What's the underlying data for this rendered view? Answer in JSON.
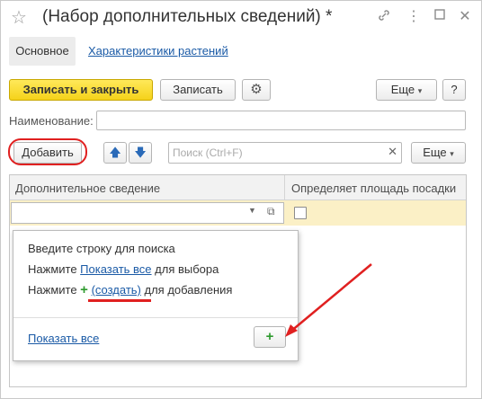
{
  "window": {
    "title": "(Набор дополнительных сведений) *",
    "link_icon": "link-icon",
    "menu_icon": "menu-icon",
    "maximize_icon": "maximize-icon",
    "close_icon": "close-icon"
  },
  "tabs": {
    "main": "Основное",
    "link": "Характеристики растений"
  },
  "toolbar": {
    "save_close": "Записать и закрыть",
    "save": "Записать",
    "more": "Еще",
    "help": "?"
  },
  "form": {
    "name_label": "Наименование:",
    "name_value": ""
  },
  "list_toolbar": {
    "add": "Добавить",
    "search_placeholder": "Поиск (Ctrl+F)",
    "more": "Еще"
  },
  "table": {
    "columns": [
      "Дополнительное сведение",
      "Определяет площадь посадки"
    ],
    "edit_value": ""
  },
  "popup": {
    "line1": "Введите строку для поиска",
    "line2_prefix": "Нажмите ",
    "line2_link": "Показать все",
    "line2_suffix": " для выбора",
    "line3_prefix": "Нажмите ",
    "line3_link": "(создать)",
    "line3_suffix": " для добавления",
    "show_all": "Показать все"
  },
  "colors": {
    "accent_yellow": "#f5d21a",
    "link_blue": "#1a5aa6",
    "annotation_red": "#e02020",
    "row_highlight": "#fbf0c6"
  }
}
